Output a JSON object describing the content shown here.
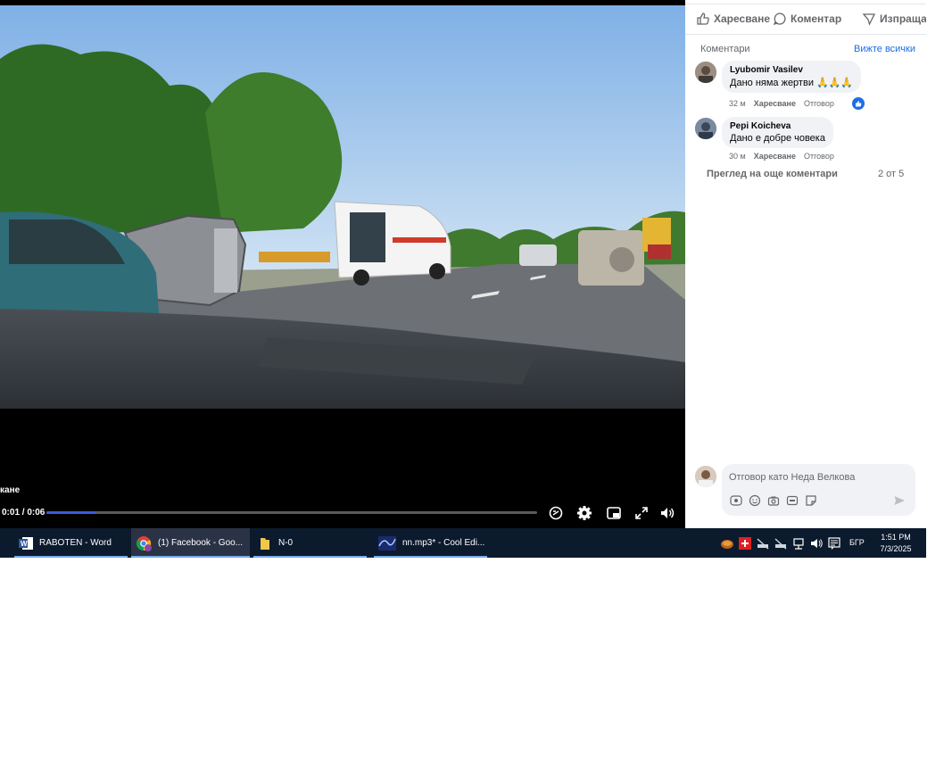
{
  "video": {
    "caption": "кане",
    "time": "0:01 / 0:06",
    "progress_fraction": 0.1
  },
  "actions": {
    "like": "Харесване",
    "comment": "Коментар",
    "share": "Изпраща"
  },
  "comments_section": {
    "header": "Коментари",
    "see_all": "Вижте всички",
    "comments": [
      {
        "author": "Lyubomir Vasilev",
        "text": "Дано няма жертви 🙏🙏🙏",
        "age": "32 м",
        "like": "Харесване",
        "reply": "Отговор",
        "reaction": "like-reaction-icon"
      },
      {
        "author": "Pepi Koicheva",
        "text": "Дано е добре човека",
        "age": "30 м",
        "like": "Харесване",
        "reply": "Отговор"
      }
    ],
    "more_comments": "Преглед на още коментари",
    "count": "2 от 5",
    "reply_placeholder": "Отговор като Неда Велкова"
  },
  "taskbar": {
    "items": [
      {
        "label": "RABOTEN - Word",
        "icon": "word-icon"
      },
      {
        "label": "(1) Facebook - Goo...",
        "icon": "chrome-icon"
      },
      {
        "label": "N-0",
        "icon": "folder-icon"
      },
      {
        "label": "nn.mp3* - Cool Edi...",
        "icon": "cool-edit-icon"
      }
    ],
    "language": "БГР",
    "time": "1:51 PM",
    "date": "7/3/2025"
  },
  "colors": {
    "accent": "#1b6fe4",
    "taskbar": "#0c1a2e",
    "bubble": "#f0f2f5"
  }
}
